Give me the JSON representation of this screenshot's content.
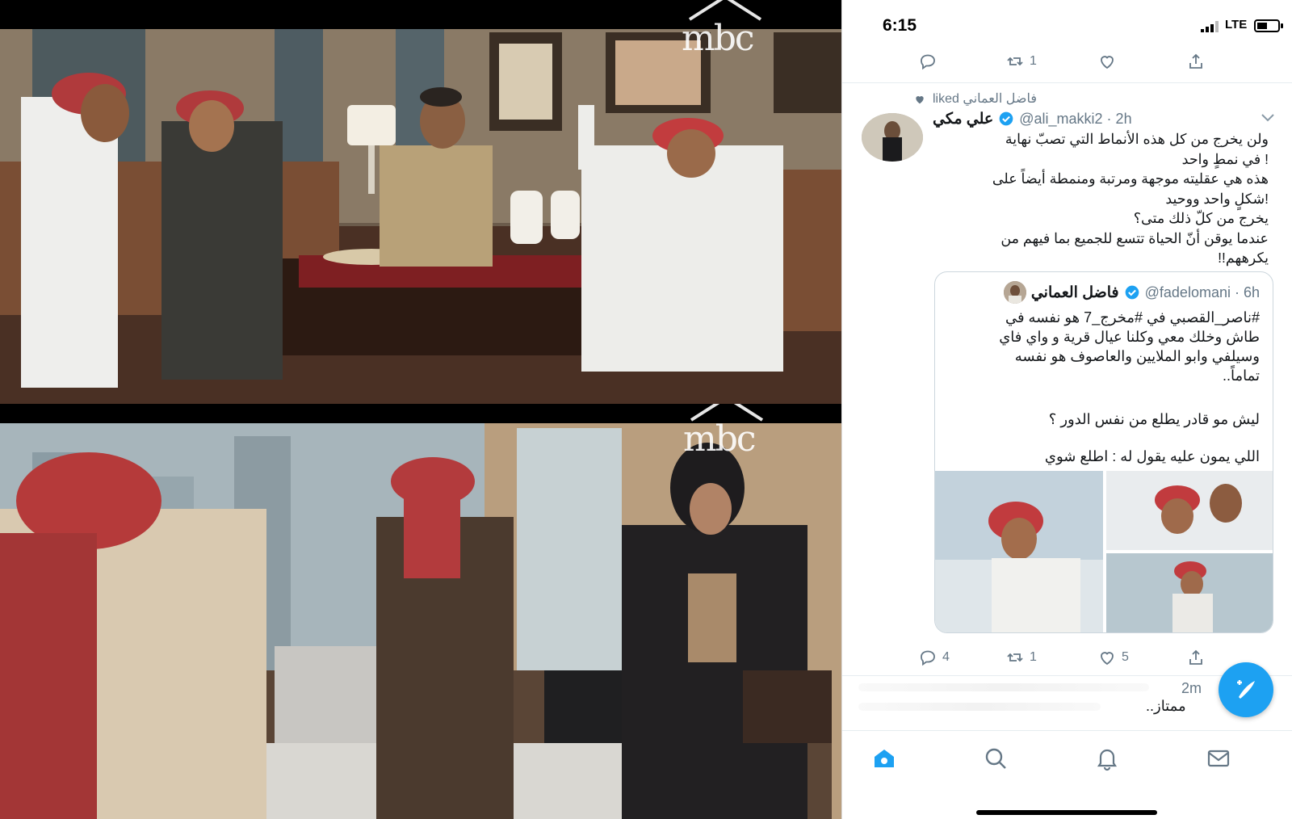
{
  "stills": {
    "top_logo": "mbc",
    "bottom_logo": "mbc"
  },
  "status_bar": {
    "time": "6:15",
    "network": "LTE"
  },
  "prev_tweet_actions": {
    "reply_count": "",
    "retweet_count": "1",
    "like_count": ""
  },
  "tweet": {
    "social_context": "فاضل العماني liked",
    "author_name": "علي مكي",
    "handle_time": "@ali_makki2 · 2h",
    "lines": [
      "ولن يخرج من كل هذه الأنماط التي تصبّ نهاية",
      "! في نمطٍ واحد",
      "هذه هي عقليته موجهة ومرتبة ومنمطة أيضاً على",
      "!شكلٍ واحد ووحيد",
      "يخرج من كلّ ذلك متى؟",
      "عندما يوقن أنّ الحياة تتسع للجميع بما فيهم من",
      "يكرههم!!"
    ],
    "quote": {
      "author_name": "فاضل العماني",
      "handle_time": "@fadelomani · 6h",
      "lines": [
        "#ناصر_القصبي في #مخرج_7 هو نفسه في",
        "طاش وخلك معي وكلنا عيال قرية و واي فاي",
        "وسيلفي وابو الملايين والعاصوف هو نفسه",
        "تماماً.."
      ],
      "question": "ليش مو قادر يطلع من نفس الدور ؟",
      "closing": "اللي يمون عليه يقول له : اطلع شوي"
    },
    "actions": {
      "reply_count": "4",
      "retweet_count": "1",
      "like_count": "5"
    }
  },
  "next_tweet": {
    "time": "2m",
    "text_fragment": "ممتاز.."
  },
  "colors": {
    "twitter_blue": "#1da1f2",
    "secondary_text": "#657786",
    "primary_text": "#14171a"
  },
  "icons": {
    "reply": "reply-icon",
    "retweet": "retweet-icon",
    "like": "heart-icon",
    "share": "share-icon",
    "compose": "compose-icon",
    "home": "home-icon",
    "search": "search-icon",
    "notifications": "bell-icon",
    "messages": "mail-icon"
  }
}
